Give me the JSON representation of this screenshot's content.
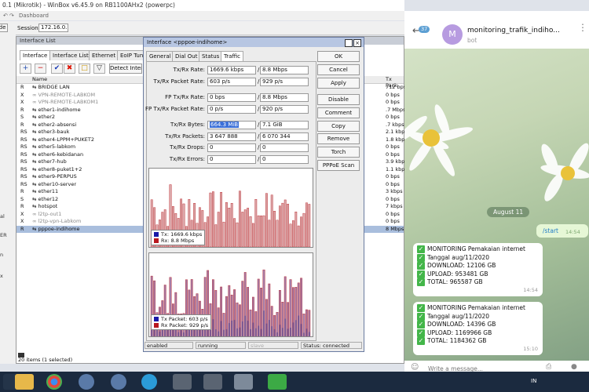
{
  "window": {
    "title": "0.1 (Mikrotik) - WinBox v6.45.9 on RB1100AHx2 (powerpc)"
  },
  "menu": {
    "dashboard": "Dashboard"
  },
  "session": {
    "left_label": "de",
    "label": "Session:",
    "value": "172.16.0.1"
  },
  "left_panel": [
    "al",
    "ER",
    "n",
    "x"
  ],
  "interface_list": {
    "title": "Interface List",
    "tabs": [
      "Interface",
      "Interface List",
      "Ethernet",
      "EoIP Tunn"
    ],
    "detect_button": "Detect Inter",
    "col_name": "Name",
    "col_txpacket": "Tx Pack",
    "rows": [
      {
        "flag": "R",
        "name": "BRIDGE LAN",
        "icon": "⇆",
        "rate": "712 bps"
      },
      {
        "flag": "X",
        "name": "VPN-REMOTE-LABKOM",
        "icon": "∞",
        "rate": "0 bps"
      },
      {
        "flag": "X",
        "name": "VPN-REMOTE-LABKOM1",
        "icon": "∞",
        "rate": "0 bps"
      },
      {
        "flag": "R",
        "name": "ether1-indihome",
        "icon": "⇆",
        "rate": ".7 Mbps"
      },
      {
        "flag": "S",
        "name": "ether2",
        "icon": "⇆",
        "rate": "0 bps"
      },
      {
        "flag": "R",
        "name": "ether2-absensi",
        "icon": "⇆",
        "rate": ".7 kbps"
      },
      {
        "flag": "RS",
        "name": "ether3-bauk",
        "icon": "⇆",
        "rate": "2.1 kbps"
      },
      {
        "flag": "RS",
        "name": "ether4-LPPM+PUKET2",
        "icon": "⇆",
        "rate": "1.8 kbps"
      },
      {
        "flag": "RS",
        "name": "ether5-labkom",
        "icon": "⇆",
        "rate": "0 bps"
      },
      {
        "flag": "RS",
        "name": "ether6-kebidanan",
        "icon": "⇆",
        "rate": "0 bps"
      },
      {
        "flag": "RS",
        "name": "ether7-hub",
        "icon": "⇆",
        "rate": "3.9 kbps"
      },
      {
        "flag": "RS",
        "name": "ether8-puket1+2",
        "icon": "⇆",
        "rate": "1.1 kbps"
      },
      {
        "flag": "RS",
        "name": "ether9-PERPUS",
        "icon": "⇆",
        "rate": "0 bps"
      },
      {
        "flag": "RS",
        "name": "ether10-server",
        "icon": "⇆",
        "rate": "0 bps"
      },
      {
        "flag": "R",
        "name": "ether11",
        "icon": "⇆",
        "rate": "3 kbps"
      },
      {
        "flag": "S",
        "name": "ether12",
        "icon": "⇆",
        "rate": "0 bps"
      },
      {
        "flag": "R",
        "name": "hotspot",
        "icon": "⇆",
        "rate": "7 kbps"
      },
      {
        "flag": "X",
        "name": "l2tp-out1",
        "icon": "∞",
        "rate": "0 bps"
      },
      {
        "flag": "X",
        "name": "l2tp-vpn-Labkom",
        "icon": "∞",
        "rate": "0 bps"
      },
      {
        "flag": "R",
        "name": "pppoe-indihome",
        "icon": "⇆",
        "rate": "8 Mbps"
      }
    ],
    "status": "20 items (1 selected)"
  },
  "dialog": {
    "title": "Interface <pppoe-indihome>",
    "tabs": [
      "General",
      "Dial Out",
      "Status",
      "Traffic"
    ],
    "fields": [
      {
        "label": "Tx/Rx Rate:",
        "v1": "1669.6 kbps",
        "v2": "8.8 Mbps"
      },
      {
        "label": "Tx/Rx Packet Rate:",
        "v1": "603 p/s",
        "v2": "929 p/s"
      },
      {
        "label": "FP Tx/Rx Rate:",
        "v1": "0 bps",
        "v2": "8.8 Mbps"
      },
      {
        "label": "FP Tx/Rx Packet Rate:",
        "v1": "0 p/s",
        "v2": "920 p/s"
      },
      {
        "label": "Tx/Rx Bytes:",
        "v1": "664.3 MiB",
        "v2": "7.1 GiB"
      },
      {
        "label": "Tx/Rx Packets:",
        "v1": "3 647 888",
        "v2": "6 070 344"
      },
      {
        "label": "Tx/Rx Drops:",
        "v1": "0",
        "v2": "0"
      },
      {
        "label": "Tx/Rx Errors:",
        "v1": "0",
        "v2": "0"
      }
    ],
    "buttons": [
      "OK",
      "Cancel",
      "Apply",
      "Disable",
      "Comment",
      "Copy",
      "Remove",
      "Torch",
      "PPPoE Scan"
    ],
    "legend1": {
      "tx": "Tx:",
      "tx_val": "1669.6 kbps",
      "rx": "Rx:",
      "rx_val": "8.8 Mbps"
    },
    "legend2": {
      "tx": "Tx Packet:",
      "tx_val": "603 p/s",
      "rx": "Rx Packet:",
      "rx_val": "929 p/s"
    },
    "status_bar": {
      "state": "enabled",
      "run": "running",
      "slave": "slave",
      "status_label": "Status:",
      "status_value": "connected"
    },
    "colors": {
      "tx": "#1a1aa8",
      "rx": "#b8191f",
      "rx_fill": "#dba7a9",
      "pkt_fill": "#a67aa4"
    }
  },
  "telegram": {
    "badge": "37",
    "avatar": "M",
    "chat_name": "monitoring_trafik_indiho...",
    "chat_sub": "bot",
    "date_badge": "August 11",
    "out_msg": "/start",
    "out_time": "14:54",
    "messages": [
      {
        "lines": [
          "MONITORING Pemakaian internet",
          "Tanggal aug/11/2020",
          "DOWNLOAD: 12106 GB",
          "UPLOAD: 953481 GB",
          "TOTAL: 965587 GB"
        ],
        "time": "14:54"
      },
      {
        "lines": [
          "MONITORING Pemakaian internet",
          "Tanggal aug/11/2020",
          "DOWNLOAD: 14396 GB",
          "UPLOAD: 1169966 GB",
          "TOTAL: 1184362 GB"
        ],
        "time": "15:10"
      }
    ],
    "input_placeholder": "Write a message..."
  },
  "taskbar": {
    "lang": "IN",
    "apps": [
      "explorer",
      "files",
      "chrome",
      "winbox",
      "winbox2",
      "telegram",
      "app7",
      "vm",
      "vm2",
      "app10",
      "camtasia"
    ]
  }
}
